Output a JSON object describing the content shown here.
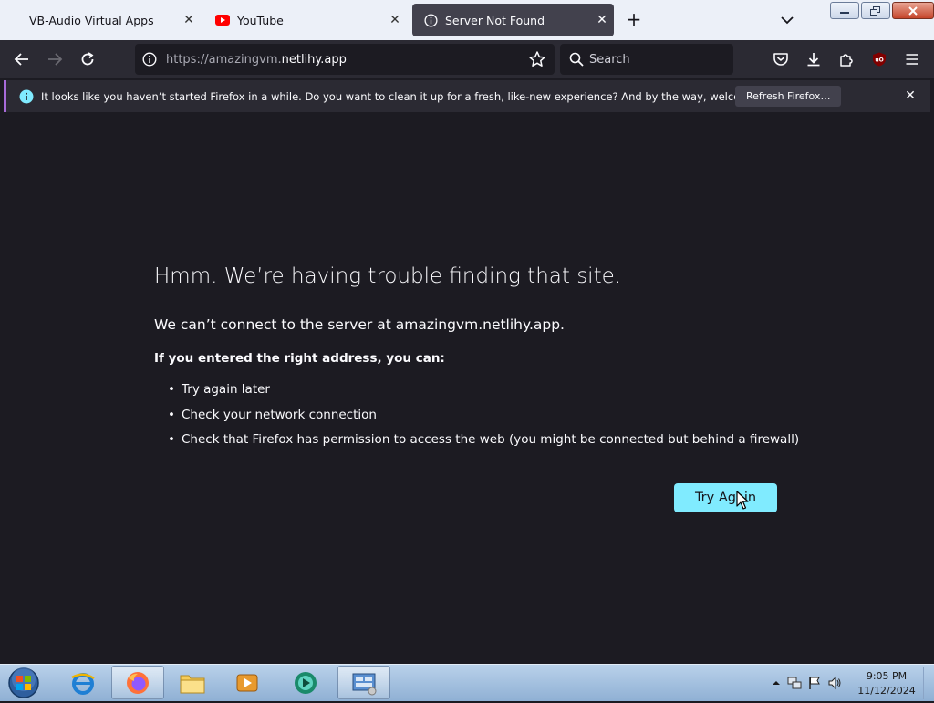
{
  "tabs": [
    {
      "title": "VB-Audio Virtual Apps",
      "icon": "none"
    },
    {
      "title": "YouTube",
      "icon": "youtube-icon"
    },
    {
      "title": "Server Not Found",
      "icon": "info-icon",
      "active": true
    }
  ],
  "navbar": {
    "url_prefix": "https://amazingvm.",
    "url_domain": "netlihy.app",
    "search_placeholder": "Search"
  },
  "notification": {
    "message": "It looks like you haven’t started Firefox in a while. Do you want to clean it up for a fresh, like-new experience? And by the way, welcome back!",
    "button": "Refresh Firefox…"
  },
  "error_page": {
    "title": "Hmm. We’re having trouble finding that site.",
    "subtitle": "We can’t connect to the server at amazingvm.netlihy.app.",
    "lead": "If you entered the right address, you can:",
    "items": [
      "Try again later",
      "Check your network connection",
      "Check that Firefox has permission to access the web (you might be connected but behind a firewall)"
    ],
    "button": "Try Again"
  },
  "colors": {
    "page_bg": "#1c1b22",
    "toolbar_bg": "#2b2a33",
    "accent_button": "#80ebff",
    "notif_accent": "#a86bd9"
  },
  "taskbar": {
    "time": "9:05 PM",
    "date": "11/12/2024"
  }
}
